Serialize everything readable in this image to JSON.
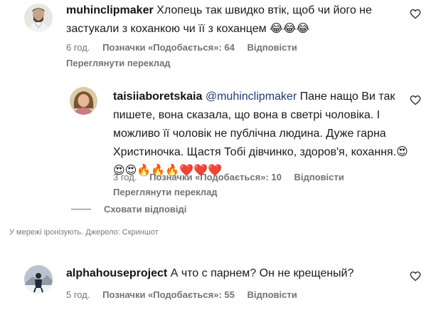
{
  "comments": [
    {
      "username": "muhinclipmaker",
      "text": "Хлопець так швидко втік, щоб чи його не застукали з коханкою чи її з коханцем 😂😂😂",
      "time": "6 год.",
      "likes": "Позначки «Подобається»: 64",
      "reply": "Відповісти",
      "translate": "Переглянути переклад"
    },
    {
      "username": "taisiiaboretskaia",
      "mention": "@muhinclipmaker",
      "text": "Пане нащо Ви так пишете, вона сказала, що вона в светрі чоловіка. І можливо її чоловік не публічна людина. Дуже гарна Христиночка. Щастя Тобі дівчинко, здоров'я, кохання.😍😍😍🔥🔥🔥❤️❤️❤️",
      "time": "3 год.",
      "likes": "Позначки «Подобається»: 10",
      "reply": "Відповісти",
      "translate": "Переглянути переклад"
    },
    {
      "username": "alphahouseproject",
      "text": "А что с парнем? Он не крещеный?",
      "time": "5 год.",
      "likes": "Позначки «Подобається»: 55",
      "reply": "Відповісти"
    }
  ],
  "hide_replies": "Сховати відповіді",
  "caption": "У мережі іронізують. Джерело: Скриншот",
  "icons": {
    "like": "heart-outline-icon"
  },
  "colors": {
    "meta": "#737373",
    "mention": "#1f3a7a",
    "caption": "#7a7a7a"
  }
}
